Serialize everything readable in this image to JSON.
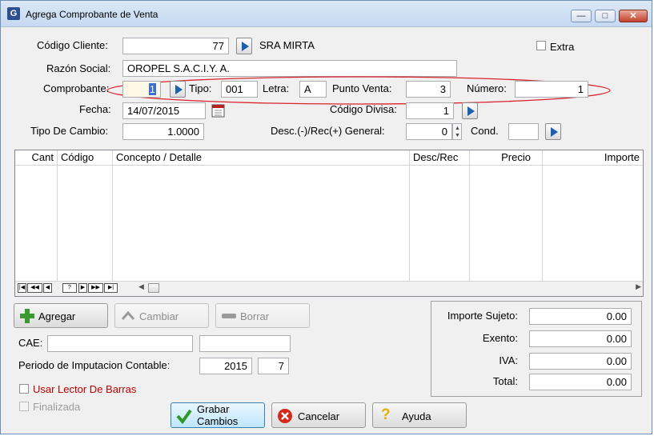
{
  "window": {
    "title": "Agrega Comprobante de Venta",
    "app_icon": "G"
  },
  "header": {
    "codigo_cliente_label": "Código Cliente:",
    "codigo_cliente_value": "77",
    "cliente_nombre": "SRA MIRTA",
    "extra_label": "Extra",
    "razon_social_label": "Razón Social:",
    "razon_social_value": "OROPEL S.A.C.I.Y. A.",
    "comprobante_label": "Comprobante:",
    "comprobante_value": "1",
    "tipo_label": "Tipo:",
    "tipo_value": "001",
    "letra_label": "Letra:",
    "letra_value": "A",
    "punto_venta_label": "Punto Venta:",
    "punto_venta_value": "3",
    "numero_label": "Número:",
    "numero_value": "1",
    "fecha_label": "Fecha:",
    "fecha_value": "14/07/2015",
    "codigo_divisa_label": "Código Divisa:",
    "codigo_divisa_value": "1",
    "tipo_cambio_label": "Tipo De Cambio:",
    "tipo_cambio_value": "1.0000",
    "desc_rec_label": "Desc.(-)/Rec(+) General:",
    "desc_rec_value": "0",
    "cond_label": "Cond.",
    "cond_value": ""
  },
  "grid": {
    "columns": [
      "Cant",
      "Código",
      "Concepto / Detalle",
      "Desc/Rec",
      "Precio",
      "Importe"
    ],
    "rows": []
  },
  "actions": {
    "agregar": "Agregar",
    "cambiar": "Cambiar",
    "borrar": "Borrar"
  },
  "cae": {
    "label": "CAE:",
    "value": "",
    "value2": ""
  },
  "periodo": {
    "label": "Periodo de Imputacion Contable:",
    "year": "2015",
    "month": "7"
  },
  "options": {
    "usar_lector_label": "Usar Lector De Barras",
    "finalizada_label": "Finalizada"
  },
  "totals": {
    "importe_sujeto_label": "Importe Sujeto:",
    "importe_sujeto_value": "0.00",
    "exento_label": "Exento:",
    "exento_value": "0.00",
    "iva_label": "IVA:",
    "iva_value": "0.00",
    "total_label": "Total:",
    "total_value": "0.00"
  },
  "footer": {
    "grabar_line1": "Grabar",
    "grabar_line2": "Cambios",
    "cancelar": "Cancelar",
    "ayuda": "Ayuda"
  },
  "colors": {
    "accent_blue": "#1a5fb0",
    "highlight_red": "#d9232d",
    "lector_label_red": "#c00000"
  }
}
